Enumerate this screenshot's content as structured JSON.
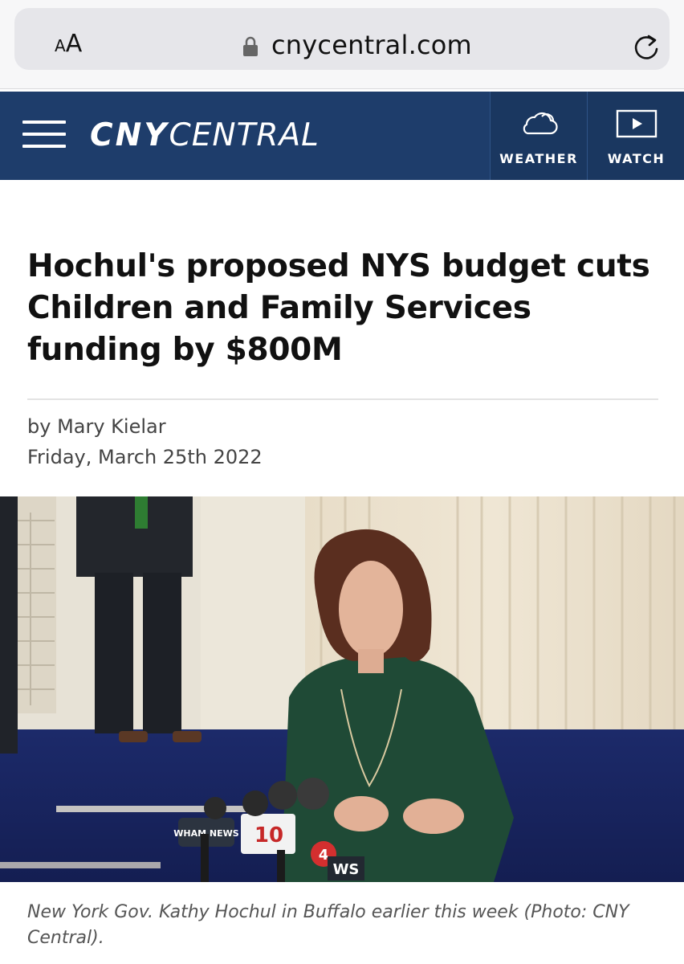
{
  "browser": {
    "aa_small": "A",
    "aa_big": "A",
    "url": "cnycentral.com"
  },
  "header": {
    "logo_bold": "CNY",
    "logo_light": "CENTRAL",
    "weather_label": "WEATHER",
    "watch_label": "WATCH",
    "brand_color": "#1e3d6b"
  },
  "article": {
    "headline": "Hochul's proposed NYS budget cuts Children and Family Services funding by $800M",
    "byline": "by Mary Kielar",
    "date": "Friday, March 25th 2022",
    "photo": {
      "mic_labels": [
        "WHAM NEWS",
        "10",
        "4",
        "WS"
      ]
    },
    "caption": "New York Gov. Kathy Hochul in Buffalo earlier this week (Photo: CNY Central)."
  }
}
